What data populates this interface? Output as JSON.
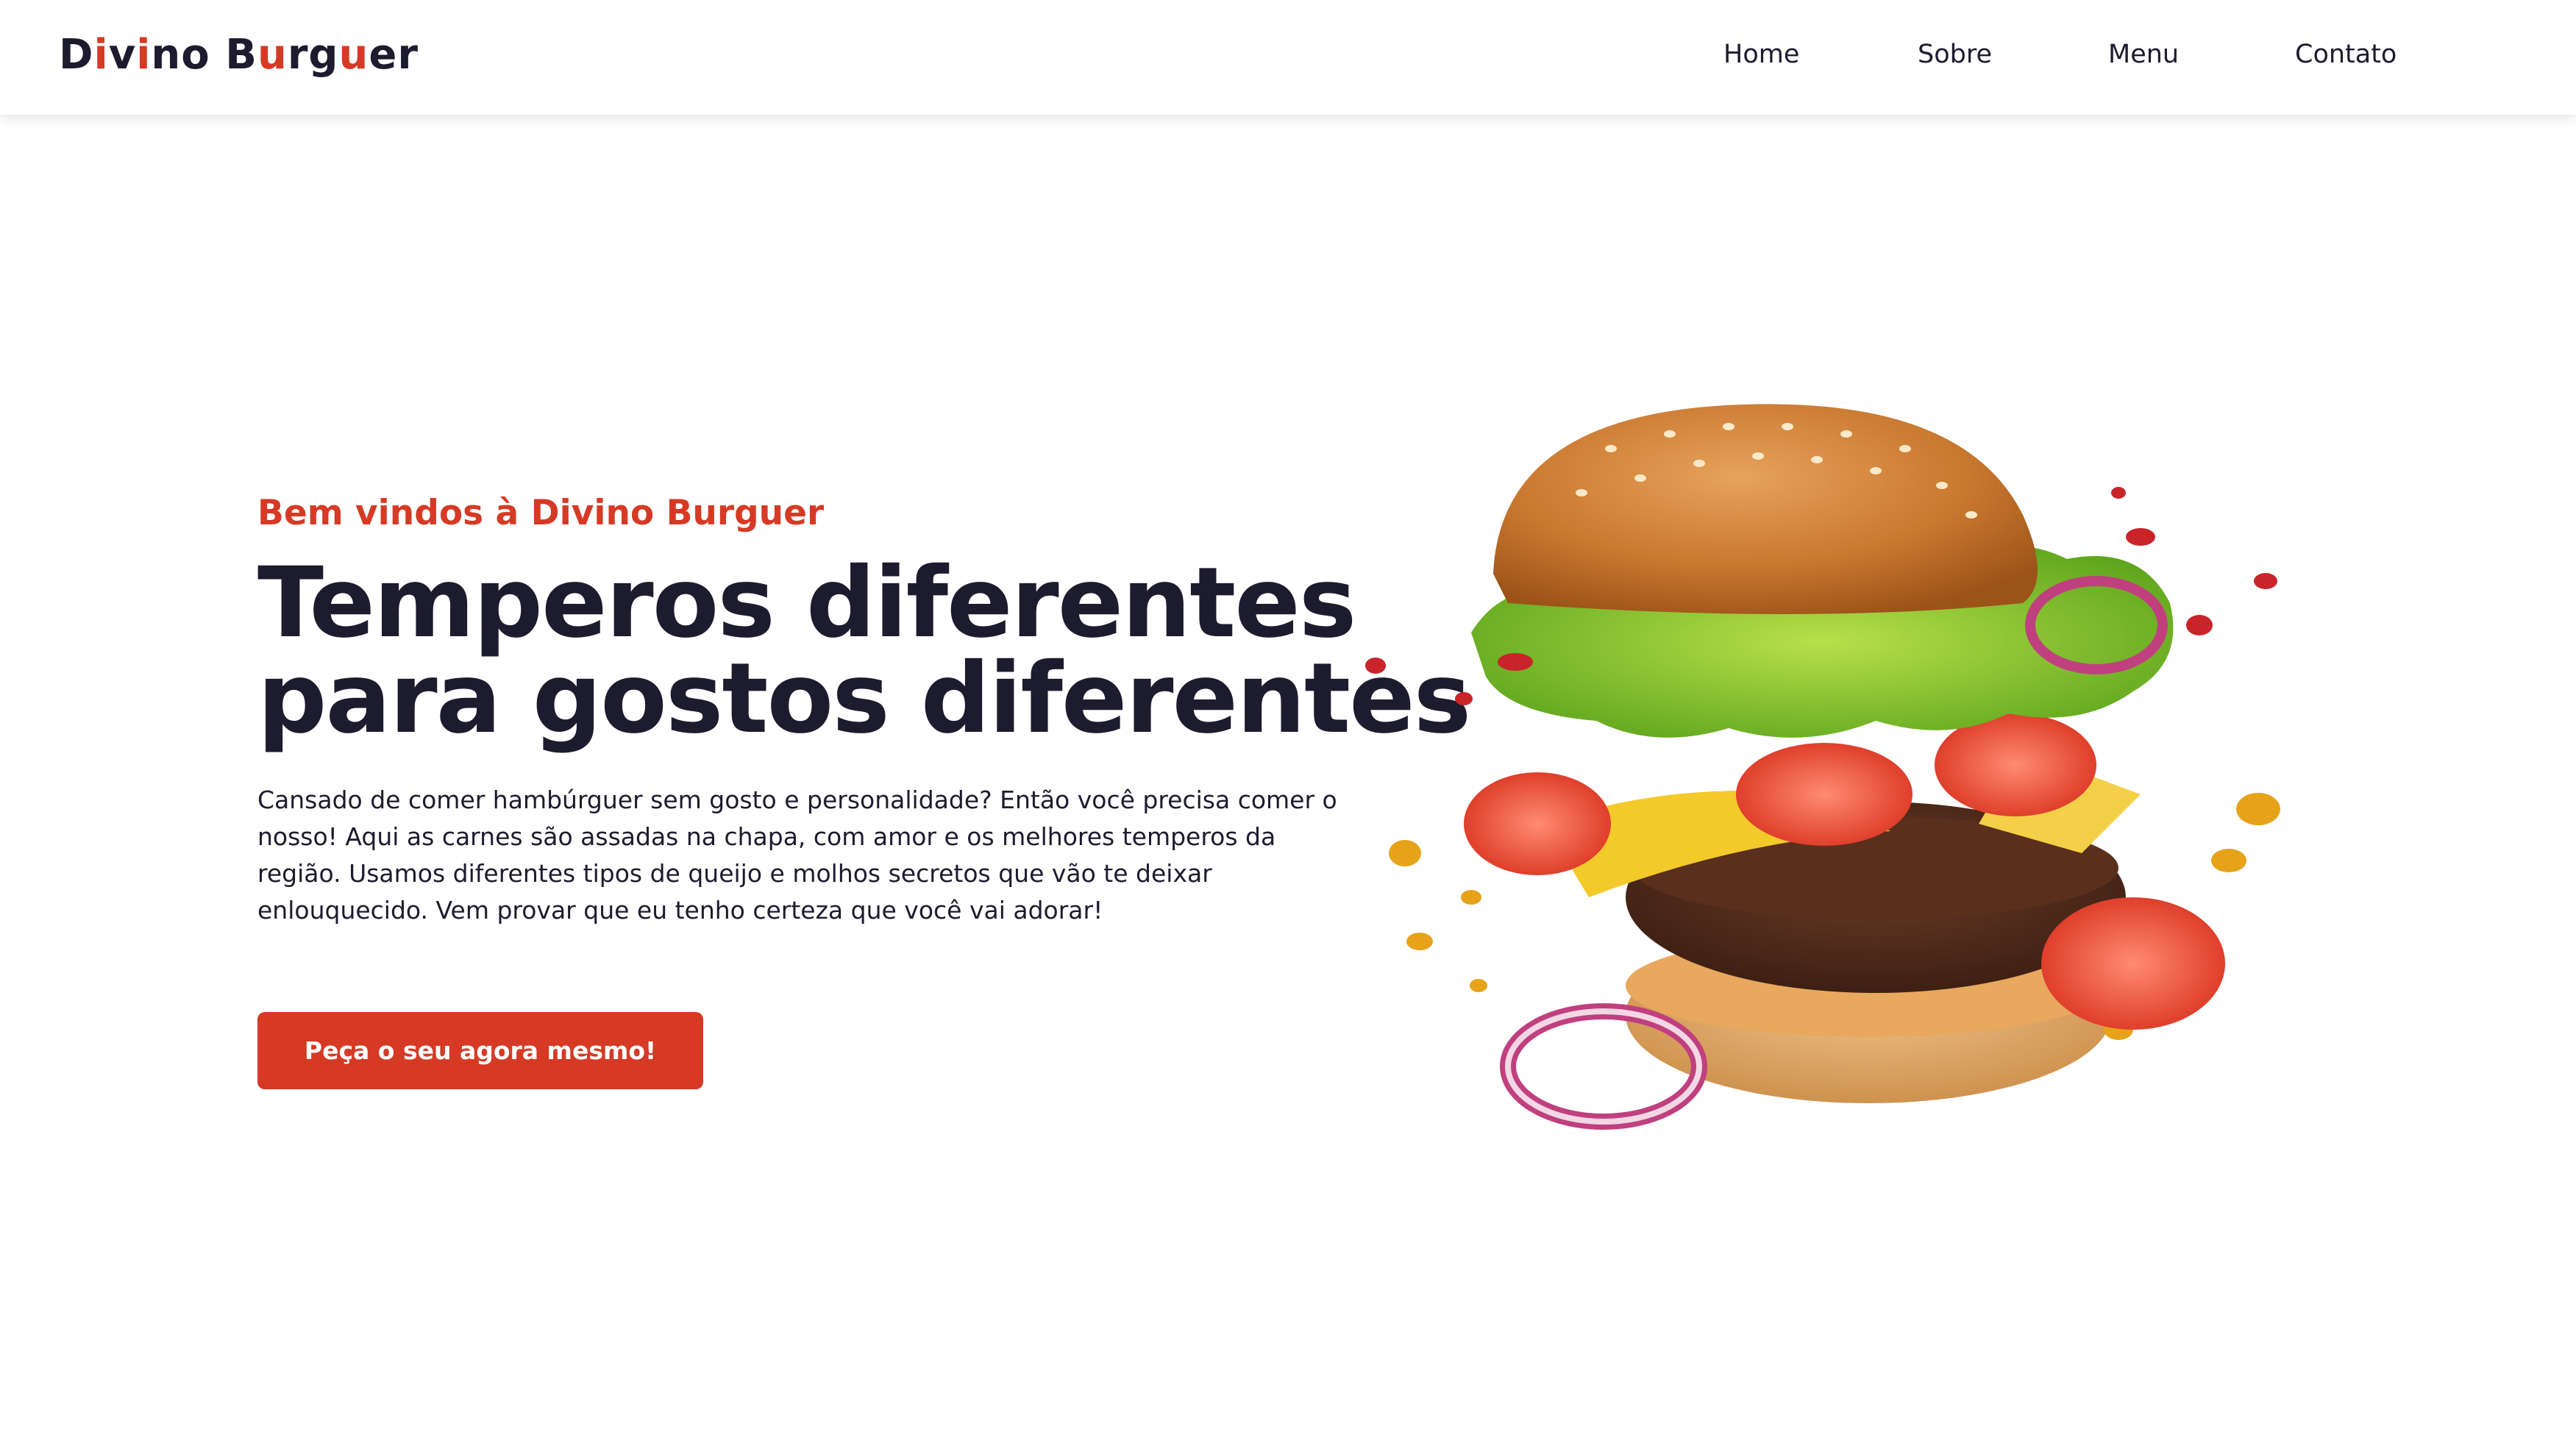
{
  "brand": {
    "logo_parts": [
      {
        "text": "D",
        "accent": false
      },
      {
        "text": "i",
        "accent": true
      },
      {
        "text": "v",
        "accent": false
      },
      {
        "text": "i",
        "accent": true
      },
      {
        "text": "no B",
        "accent": false
      },
      {
        "text": "u",
        "accent": true
      },
      {
        "text": "rg",
        "accent": false
      },
      {
        "text": "u",
        "accent": true
      },
      {
        "text": "er",
        "accent": false
      }
    ]
  },
  "nav": {
    "items": [
      {
        "label": "Home"
      },
      {
        "label": "Sobre"
      },
      {
        "label": "Menu"
      },
      {
        "label": "Contato"
      }
    ]
  },
  "hero": {
    "welcome": "Bem vindos à Divino Burguer",
    "headline_line1": "Temperos diferentes",
    "headline_line2": "para gostos diferentes",
    "description": "Cansado de comer hambúrguer sem gosto e personalidade? Então você precisa comer o nosso! Aqui as carnes são assadas na chapa, com amor e os melhores temperos da região. Usamos diferentes tipos de queijo e molhos secretos que vão te deixar enlouquecido. Vem provar que eu tenho certeza que você vai adorar!",
    "cta_label": "Peça o seu agora mesmo!"
  },
  "colors": {
    "accent": "#d63a25",
    "text": "#1d1b2e",
    "background": "#ffffff"
  }
}
